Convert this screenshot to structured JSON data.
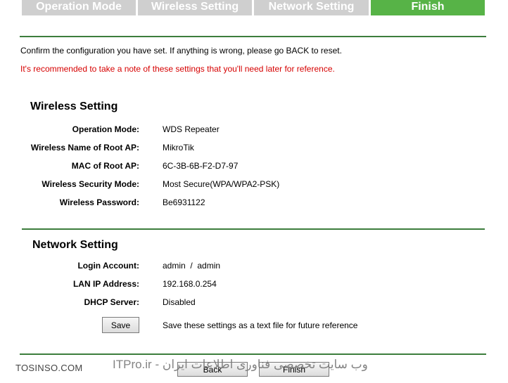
{
  "tabs": [
    {
      "label": "Operation Mode",
      "active": false
    },
    {
      "label": "Wireless Setting",
      "active": false
    },
    {
      "label": "Network Setting",
      "active": false
    },
    {
      "label": "Finish",
      "active": true
    }
  ],
  "intro": {
    "confirm_text": "Confirm the configuration you have set. If anything is wrong, please go BACK to reset.",
    "note_text": "It's recommended to take a note of these settings that you'll need later for reference."
  },
  "wireless": {
    "title": "Wireless Setting",
    "rows": [
      {
        "label": "Operation Mode:",
        "value": "WDS Repeater"
      },
      {
        "label": "Wireless Name of Root AP:",
        "value": "MikroTik"
      },
      {
        "label": "MAC of Root AP:",
        "value": "6C-3B-6B-F2-D7-97"
      },
      {
        "label": "Wireless Security Mode:",
        "value": "Most Secure(WPA/WPA2-PSK)"
      },
      {
        "label": "Wireless Password:",
        "value": "Be6931122"
      }
    ]
  },
  "network": {
    "title": "Network Setting",
    "rows": [
      {
        "label": "Login Account:",
        "value": "admin  /  admin"
      },
      {
        "label": "LAN IP Address:",
        "value": "192.168.0.254"
      },
      {
        "label": "DHCP Server:",
        "value": "Disabled"
      }
    ],
    "save_label": "Save",
    "save_note": "Save these settings as a text file for future reference"
  },
  "footer": {
    "back_label": "Back",
    "finish_label": "Finish"
  },
  "watermark": {
    "left": "TOSINSO.COM",
    "right": "ITPro.ir - وب سایت تخصصی فناوری اطلاعات ایران"
  },
  "colors": {
    "tab_active": "#57b347",
    "tab_inactive": "#cfcfcf",
    "rule": "#3c7d3c",
    "warning": "#d60000"
  }
}
